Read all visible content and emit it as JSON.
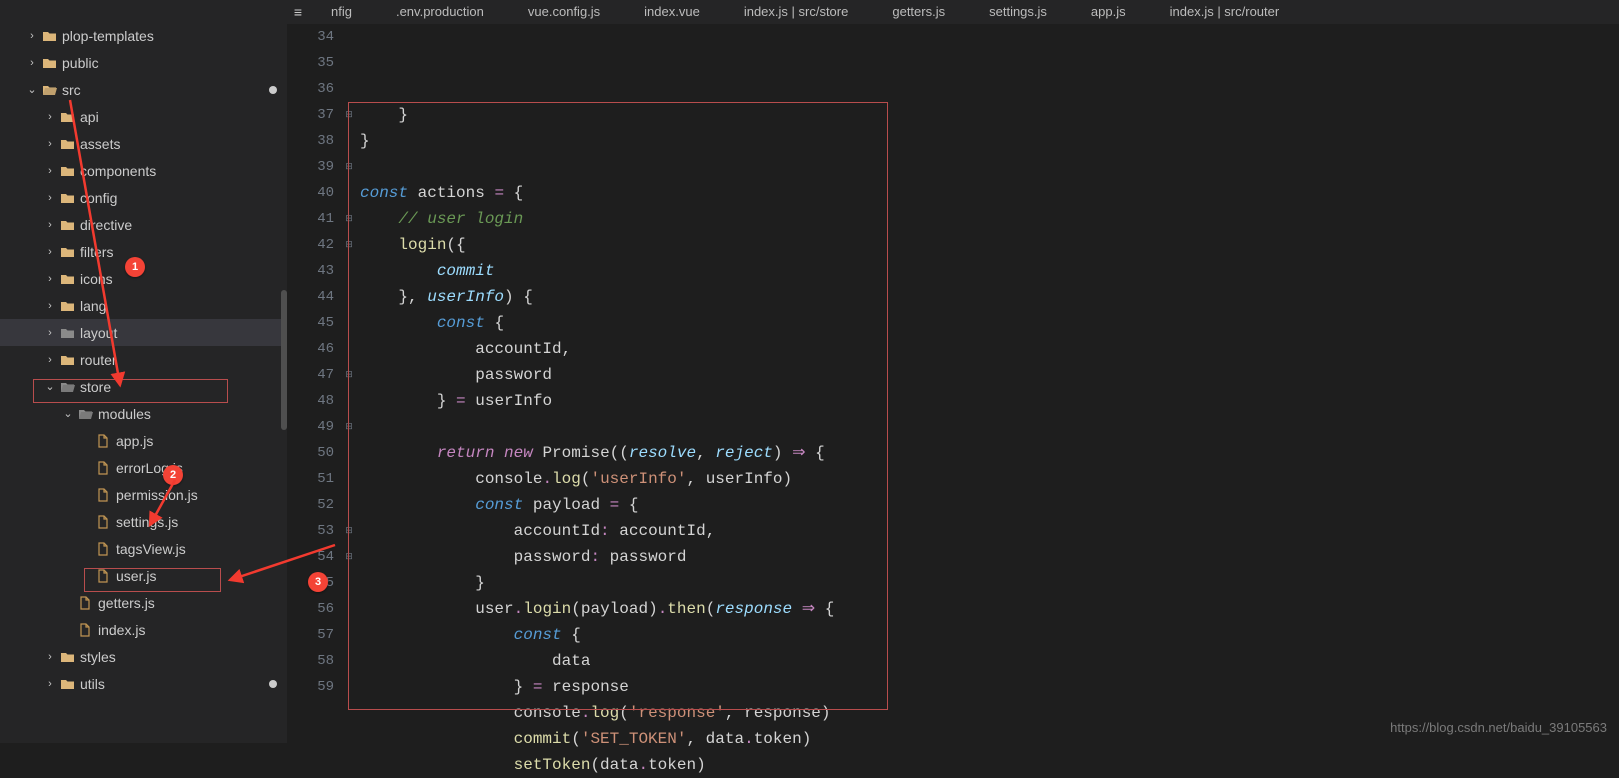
{
  "tabs": {
    "items": [
      "nfig",
      ".env.production",
      "vue.config.js",
      "index.vue",
      "index.js | src/store",
      "getters.js",
      "settings.js",
      "app.js",
      "index.js | src/router"
    ],
    "activeIndex": 0
  },
  "tree": {
    "items": [
      {
        "depth": 0,
        "chev": ">",
        "icon": "folder-y",
        "label": "plop-templates"
      },
      {
        "depth": 0,
        "chev": ">",
        "icon": "folder-y",
        "label": "public"
      },
      {
        "depth": 0,
        "chev": "v",
        "icon": "folder-y",
        "label": "src",
        "modified": true
      },
      {
        "depth": 1,
        "chev": ">",
        "icon": "folder-y",
        "label": "api"
      },
      {
        "depth": 1,
        "chev": ">",
        "icon": "folder-y",
        "label": "assets"
      },
      {
        "depth": 1,
        "chev": ">",
        "icon": "folder-y",
        "label": "components"
      },
      {
        "depth": 1,
        "chev": ">",
        "icon": "folder-y",
        "label": "config"
      },
      {
        "depth": 1,
        "chev": ">",
        "icon": "folder-y",
        "label": "directive"
      },
      {
        "depth": 1,
        "chev": ">",
        "icon": "folder-y",
        "label": "filters"
      },
      {
        "depth": 1,
        "chev": ">",
        "icon": "folder-y",
        "label": "icons"
      },
      {
        "depth": 1,
        "chev": ">",
        "icon": "folder-y",
        "label": "lang"
      },
      {
        "depth": 1,
        "chev": ">",
        "icon": "folder-g",
        "label": "layout",
        "hl": true
      },
      {
        "depth": 1,
        "chev": ">",
        "icon": "folder-y",
        "label": "router"
      },
      {
        "depth": 1,
        "chev": "v",
        "icon": "folder-g",
        "label": "store"
      },
      {
        "depth": 2,
        "chev": "v",
        "icon": "folder-g",
        "label": "modules"
      },
      {
        "depth": 3,
        "chev": "",
        "icon": "file-x",
        "label": "app.js"
      },
      {
        "depth": 3,
        "chev": "",
        "icon": "file-x",
        "label": "errorLog.js"
      },
      {
        "depth": 3,
        "chev": "",
        "icon": "file-x",
        "label": "permission.js"
      },
      {
        "depth": 3,
        "chev": "",
        "icon": "file-x",
        "label": "settings.js"
      },
      {
        "depth": 3,
        "chev": "",
        "icon": "file-x",
        "label": "tagsView.js"
      },
      {
        "depth": 3,
        "chev": "",
        "icon": "file-x",
        "label": "user.js"
      },
      {
        "depth": 2,
        "chev": "",
        "icon": "file-x",
        "label": "getters.js"
      },
      {
        "depth": 2,
        "chev": "",
        "icon": "file-x",
        "label": "index.js"
      },
      {
        "depth": 1,
        "chev": ">",
        "icon": "folder-y",
        "label": "styles"
      },
      {
        "depth": 1,
        "chev": ">",
        "icon": "folder-y",
        "label": "utils",
        "modified": true
      }
    ]
  },
  "gutter": {
    "start": 34,
    "end": 59,
    "foldMarks": {
      "37": "⊟",
      "39": "⊟",
      "41": "⊟",
      "42": "⊟",
      "47": "⊟",
      "49": "⊟",
      "53": "⊟",
      "54": "⊟"
    }
  },
  "code": {
    "34": [
      [
        "brace",
        "    }"
      ]
    ],
    "35": [
      [
        "brace",
        "}"
      ]
    ],
    "36": [
      [
        "",
        ""
      ]
    ],
    "37": [
      [
        "decl",
        "const"
      ],
      [
        "",
        " "
      ],
      [
        "id",
        "actions"
      ],
      [
        "",
        " "
      ],
      [
        "op",
        "="
      ],
      [
        "",
        " "
      ],
      [
        "brace",
        "{"
      ]
    ],
    "38": [
      [
        "",
        "    "
      ],
      [
        "cmt",
        "// user login"
      ]
    ],
    "39": [
      [
        "",
        "    "
      ],
      [
        "fn",
        "login"
      ],
      [
        "",
        "("
      ],
      [
        "brace",
        "{"
      ]
    ],
    "40": [
      [
        "",
        "        "
      ],
      [
        "param",
        "commit"
      ]
    ],
    "41": [
      [
        "",
        "    "
      ],
      [
        "brace",
        "}"
      ],
      [
        "",
        ", "
      ],
      [
        "param",
        "userInfo"
      ],
      [
        "",
        ")"
      ],
      [
        "",
        " "
      ],
      [
        "brace",
        "{"
      ]
    ],
    "42": [
      [
        "",
        "        "
      ],
      [
        "decl",
        "const"
      ],
      [
        "",
        " "
      ],
      [
        "brace",
        "{"
      ]
    ],
    "43": [
      [
        "",
        "            "
      ],
      [
        "id",
        "accountId"
      ],
      [
        "",
        ","
      ]
    ],
    "44": [
      [
        "",
        "            "
      ],
      [
        "id",
        "password"
      ]
    ],
    "45": [
      [
        "",
        "        "
      ],
      [
        "brace",
        "}"
      ],
      [
        "",
        " "
      ],
      [
        "op",
        "="
      ],
      [
        "",
        " "
      ],
      [
        "id",
        "userInfo"
      ]
    ],
    "46": [
      [
        "",
        ""
      ]
    ],
    "47": [
      [
        "",
        "        "
      ],
      [
        "kw",
        "return"
      ],
      [
        "",
        " "
      ],
      [
        "kw",
        "new"
      ],
      [
        "",
        " "
      ],
      [
        "id",
        "Promise"
      ],
      [
        "",
        "(("
      ],
      [
        "param",
        "resolve"
      ],
      [
        "",
        ", "
      ],
      [
        "param",
        "reject"
      ],
      [
        "",
        ")"
      ],
      [
        "",
        " "
      ],
      [
        "arrow",
        "⇒"
      ],
      [
        "",
        " "
      ],
      [
        "brace",
        "{"
      ]
    ],
    "48": [
      [
        "",
        "            "
      ],
      [
        "id",
        "console"
      ],
      [
        "op",
        "."
      ],
      [
        "fn",
        "log"
      ],
      [
        "",
        "("
      ],
      [
        "str",
        "'userInfo'"
      ],
      [
        "",
        ", "
      ],
      [
        "id",
        "userInfo"
      ],
      [
        "",
        ")"
      ]
    ],
    "49": [
      [
        "",
        "            "
      ],
      [
        "decl",
        "const"
      ],
      [
        "",
        " "
      ],
      [
        "id",
        "payload"
      ],
      [
        "",
        " "
      ],
      [
        "op",
        "="
      ],
      [
        "",
        " "
      ],
      [
        "brace",
        "{"
      ]
    ],
    "50": [
      [
        "",
        "                "
      ],
      [
        "id",
        "accountId"
      ],
      [
        "op",
        ":"
      ],
      [
        "",
        " "
      ],
      [
        "id",
        "accountId"
      ],
      [
        "",
        ","
      ]
    ],
    "51": [
      [
        "",
        "                "
      ],
      [
        "id",
        "password"
      ],
      [
        "op",
        ":"
      ],
      [
        "",
        " "
      ],
      [
        "id",
        "password"
      ]
    ],
    "52": [
      [
        "",
        "            "
      ],
      [
        "brace",
        "}"
      ]
    ],
    "53": [
      [
        "",
        "            "
      ],
      [
        "id",
        "user"
      ],
      [
        "op",
        "."
      ],
      [
        "fn",
        "login"
      ],
      [
        "",
        "("
      ],
      [
        "id",
        "payload"
      ],
      [
        "",
        ")"
      ],
      [
        "op",
        "."
      ],
      [
        "fn",
        "then"
      ],
      [
        "",
        "("
      ],
      [
        "param",
        "response"
      ],
      [
        "",
        " "
      ],
      [
        "arrow",
        "⇒"
      ],
      [
        "",
        " "
      ],
      [
        "brace",
        "{"
      ]
    ],
    "54": [
      [
        "",
        "                "
      ],
      [
        "decl",
        "const"
      ],
      [
        "",
        " "
      ],
      [
        "brace",
        "{"
      ]
    ],
    "55": [
      [
        "",
        "                    "
      ],
      [
        "id",
        "data"
      ]
    ],
    "56": [
      [
        "",
        "                "
      ],
      [
        "brace",
        "}"
      ],
      [
        "",
        " "
      ],
      [
        "op",
        "="
      ],
      [
        "",
        " "
      ],
      [
        "id",
        "response"
      ]
    ],
    "57": [
      [
        "",
        "                "
      ],
      [
        "id",
        "console"
      ],
      [
        "op",
        "."
      ],
      [
        "fn",
        "log"
      ],
      [
        "",
        "("
      ],
      [
        "str",
        "'response'"
      ],
      [
        "",
        ", "
      ],
      [
        "id",
        "response"
      ],
      [
        "",
        ")"
      ]
    ],
    "58": [
      [
        "",
        "                "
      ],
      [
        "fn",
        "commit"
      ],
      [
        "",
        "("
      ],
      [
        "str",
        "'SET_TOKEN'"
      ],
      [
        "",
        ", "
      ],
      [
        "id",
        "data"
      ],
      [
        "op",
        "."
      ],
      [
        "id",
        "token"
      ],
      [
        "",
        ")"
      ]
    ],
    "59": [
      [
        "",
        "                "
      ],
      [
        "fn",
        "setToken"
      ],
      [
        "",
        "("
      ],
      [
        "id",
        "data"
      ],
      [
        "op",
        "."
      ],
      [
        "id",
        "token"
      ],
      [
        "",
        ")"
      ]
    ]
  },
  "annotations": {
    "circle1": "1",
    "circle2": "2",
    "circle3": "3"
  },
  "watermark": "https://blog.csdn.net/baidu_39105563"
}
